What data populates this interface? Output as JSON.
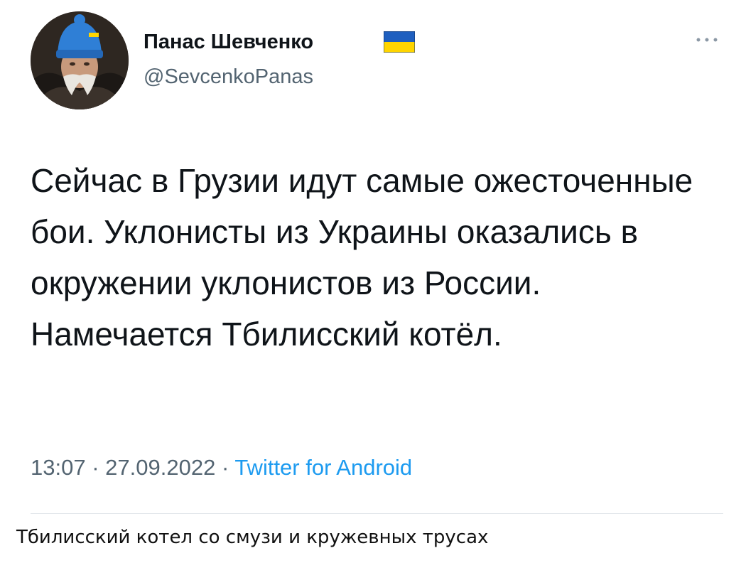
{
  "tweet": {
    "author": {
      "display_name": "Панас Шевченко",
      "username": "@SevcenkoPanas",
      "flag_colors": {
        "top": "#1f5fbf",
        "bottom": "#ffd500"
      }
    },
    "text": "Сейчас в Грузии идут самые ожесточенные бои. Уклонисты из Украины оказались в окружении уклонистов из России. Намечается Тбилисский котёл.",
    "time": "13:07",
    "date": "27.09.2022",
    "separator": "·",
    "source": "Twitter for Android",
    "more_icon": "ellipsis-icon"
  },
  "caption": "Тбилисский котел со смузи и кружевных трусах",
  "colors": {
    "secondary_text": "#536471",
    "link": "#1d9bf0",
    "divider": "#e1e6ea"
  }
}
